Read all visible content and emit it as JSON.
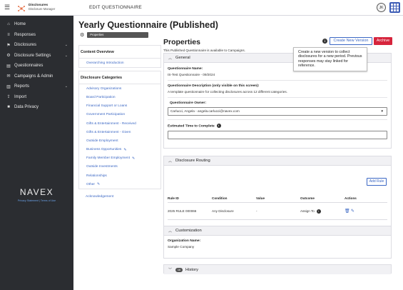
{
  "header": {
    "app_title": "Disclosures",
    "app_subtitle": "Disclosure Manager",
    "page_heading": "EDIT QUESTIONNAIRE",
    "user_initials": "JK",
    "accent_color": "#3b5bb5"
  },
  "sidebar": {
    "items": [
      {
        "label": "Home",
        "icon": "home-icon",
        "glyph": "⌂"
      },
      {
        "label": "Responses",
        "icon": "list-icon",
        "glyph": "≡"
      },
      {
        "label": "Disclosures",
        "icon": "flag-icon",
        "glyph": "⚑"
      },
      {
        "label": "Disclosure Settings",
        "icon": "gear-icon",
        "glyph": "⚙"
      },
      {
        "label": "Questionnaires",
        "icon": "document-icon",
        "glyph": "▤"
      },
      {
        "label": "Campaigns & Admin",
        "icon": "campaign-icon",
        "glyph": "✉"
      },
      {
        "label": "Reports",
        "icon": "chart-icon",
        "glyph": "▥"
      },
      {
        "label": "Import",
        "icon": "upload-icon",
        "glyph": "⇪"
      },
      {
        "label": "Data Privacy",
        "icon": "shield-icon",
        "glyph": "■"
      }
    ],
    "brand": "NAVEX",
    "brand_links": "Privacy Statement  |  Terms of Use"
  },
  "main": {
    "questionnaire_title": "Yearly Questionnaire (Published)",
    "properties_chip": "Properties",
    "content_overview_title": "Content Overview",
    "overarching_link": "Overarching Introduction",
    "categories_title": "Disclosure Categories",
    "categories": [
      "Advisory Organizations",
      "Board Participation",
      "Financial Support or Loans",
      "Government Participation",
      "Gifts & Entertainment - Received",
      "Gifts & Entertainment - Given",
      "Outside Employment",
      "Business Opportunities",
      "Family Member Employment",
      "Outside Investments",
      "Relationships",
      "Other"
    ],
    "acknowledgement_link": "Acknowledgement",
    "properties_heading": "Properties",
    "create_version_label": "Create New Version",
    "archive_label": "Archive",
    "tooltip_text": "Create a new version to collect disclosures for a new period. Previous responses may stay linked for reference.",
    "published_note": "This Published Questionnaire is available to Campaigns."
  },
  "general": {
    "heading": "General",
    "name_label": "Questionnaire Name:",
    "name_value": "IS-Test Questionnaire - 09/2024",
    "desc_label": "Questionnaire Description (only visible on this screen):",
    "desc_value": "A template questionnaire for collecting disclosures across 12 different categories.",
    "owner_label": "Questionnaire Owner:",
    "owner_value": "Carlucci, Angela - angela.carlucci@navex.com",
    "time_label": "Estimated Time to Complete"
  },
  "routing": {
    "heading": "Disclosure Routing",
    "add_rule_label": "Add Rule",
    "columns": [
      "Rule ID",
      "Condition",
      "Value",
      "Outcome",
      "Actions"
    ],
    "rows": [
      {
        "rule_id": "2025 RULE 000066",
        "condition": "Any Disclosure",
        "value": "-",
        "outcome": "Assign To"
      }
    ]
  },
  "customization": {
    "heading": "Customization",
    "org_label": "Organization Name:",
    "org_value": "Sample Company"
  },
  "history": {
    "heading": "History",
    "count": "16"
  }
}
